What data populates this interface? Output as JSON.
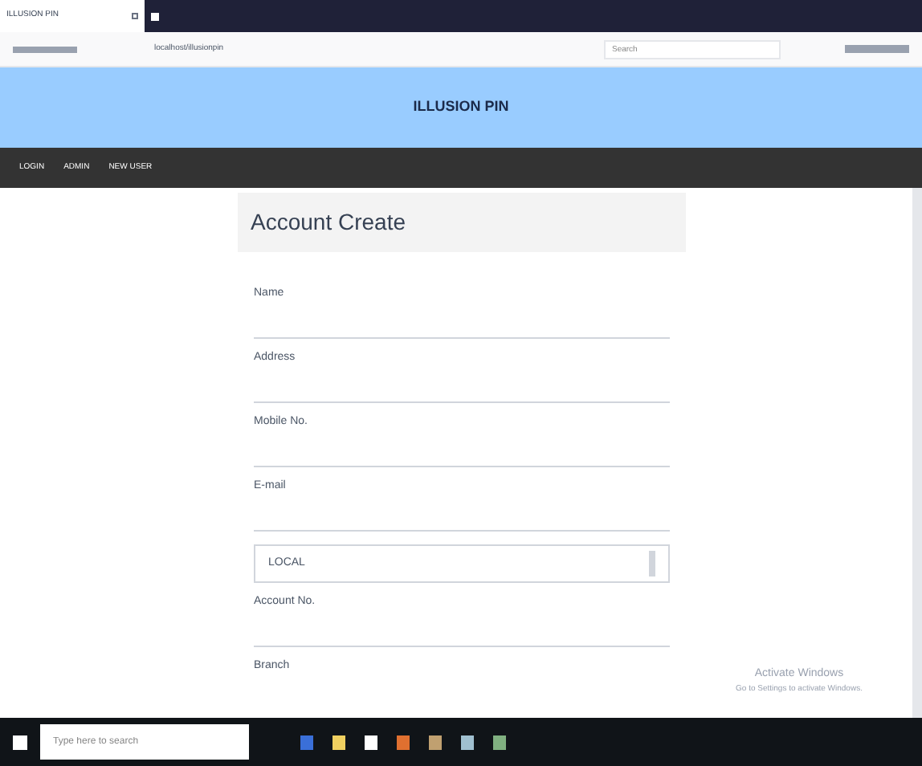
{
  "browser": {
    "tab_title": "ILLUSION PIN",
    "url": "localhost/illusionpin",
    "search_placeholder": "Search"
  },
  "header": {
    "title": "ILLUSION PIN"
  },
  "nav": [
    {
      "label": "LOGIN"
    },
    {
      "label": "ADMIN"
    },
    {
      "label": "NEW USER"
    }
  ],
  "form": {
    "title": "Account Create",
    "fields": [
      {
        "kind": "input",
        "label": "Name"
      },
      {
        "kind": "input",
        "label": "Address"
      },
      {
        "kind": "input",
        "label": "Mobile No."
      },
      {
        "kind": "input",
        "label": "E-mail"
      },
      {
        "kind": "select",
        "value": "LOCAL"
      },
      {
        "kind": "input",
        "label": "Account No."
      },
      {
        "kind": "label",
        "label": "Branch"
      }
    ]
  },
  "activation": {
    "title": "Activate Windows",
    "note": "Go to Settings to activate Windows."
  },
  "taskbar": {
    "search_placeholder": "Type here to search"
  }
}
